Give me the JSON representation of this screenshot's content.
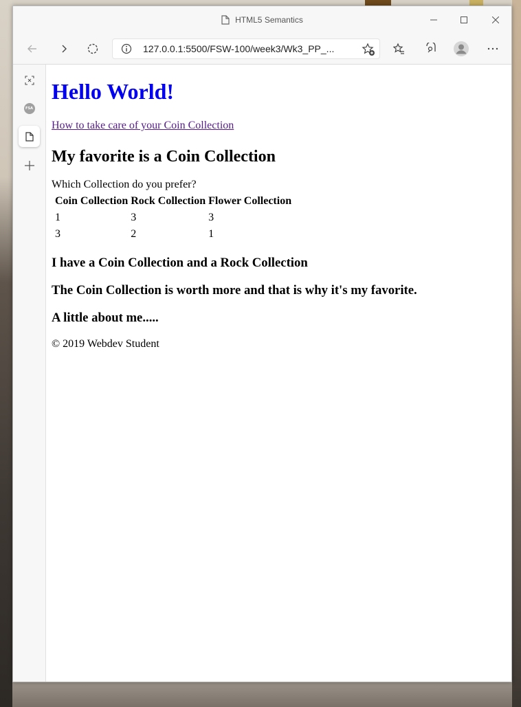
{
  "window": {
    "title": "HTML5 Semantics",
    "controls": {
      "minimize": "—",
      "maximize": "☐",
      "close": "✕"
    }
  },
  "toolbar": {
    "url": "127.0.0.1:5500/FSW-100/week3/Wk3_PP_...",
    "icons": [
      "back-icon",
      "forward-icon",
      "refresh-icon",
      "info-icon",
      "add-favorite-icon",
      "favorites-icon",
      "collections-icon",
      "profile-icon",
      "more-icon"
    ]
  },
  "sidebar": {
    "items": [
      {
        "icon": "tab-actions-icon"
      },
      {
        "icon": "fsa-tab-icon",
        "label": "FSA"
      },
      {
        "icon": "page-tab-icon",
        "active": true
      },
      {
        "icon": "new-tab-icon"
      }
    ]
  },
  "page": {
    "heading": "Hello World!",
    "link": "How to take care of your Coin Collection",
    "subheading": "My favorite is a Coin Collection",
    "question": "Which Collection do you prefer?",
    "table": {
      "headers": [
        "Coin Collection",
        "Rock Collection",
        "Flower Collection"
      ],
      "rows": [
        [
          "1",
          "3",
          "3"
        ],
        [
          "3",
          "2",
          "1"
        ]
      ]
    },
    "line1": "I have a Coin Collection and a Rock Collection",
    "line2": "The Coin Collection is worth more and that is why it's my favorite.",
    "line3": "A little about me.....",
    "footer": "© 2019 Webdev Student"
  },
  "colors": {
    "heading": "#0000ee",
    "visited_link": "#551a8b",
    "chrome": "#f7f7f7"
  }
}
